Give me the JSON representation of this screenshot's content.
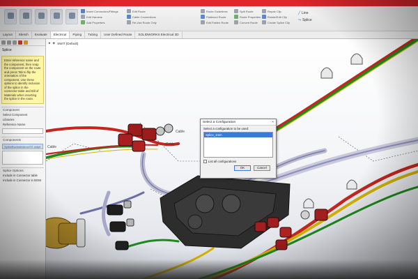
{
  "ribbon": {
    "groups": [
      [
        "Insert Connectors/Fittings",
        "Edit Harness",
        "Add Properties"
      ],
      [
        "Edit Route",
        "Cable Connections",
        "Re-Use Route Only"
      ],
      [
        "Route Guidelines",
        "Flattened Route",
        "Edit Flatten Route"
      ],
      [
        "Split Route",
        "Route Properties",
        "Convert Route"
      ],
      [
        "Repair Clip",
        "Rotate/Edit Clip",
        "Create Splice Clip"
      ]
    ],
    "side": [
      "Line",
      "Splice"
    ]
  },
  "tabs": [
    "Layout",
    "Sketch",
    "Evaluate",
    "Electrical",
    "Piping",
    "Tubing",
    "User Defined Route",
    "SOLIDWORKS Electrical 3D"
  ],
  "active_tab": "Electrical",
  "panel": {
    "title": "Splice",
    "message": "Enter reference name and the component, then snap the component on the route and press Tab to flip the orientation of the component. Use these options to identify inclusion of the splice in the connector table and Bill of Materials when inserting the splice in the route.",
    "sections": {
      "component": "Component",
      "select_component": "Select Component",
      "libraries": "Libraries",
      "reference_name": "Reference Name",
      "components": "Components",
      "part_file": "SpliceBuchsteckboxGS.sldprt",
      "options": "Splice Options",
      "include_connector_table": "Include in Connector table",
      "include_bom": "Include in Connector in BOM"
    }
  },
  "viewport": {
    "tree_label": "SWIT (Default)",
    "labels": [
      "Cable",
      "Cable",
      "Cable"
    ]
  },
  "dialog": {
    "title": "Select a Configuration",
    "prompt": "Select a configuration to be used:",
    "items": [
      "Splice_1mm"
    ],
    "checkbox": "List all configurations",
    "ok": "OK",
    "cancel": "Cancel",
    "close": "×"
  }
}
